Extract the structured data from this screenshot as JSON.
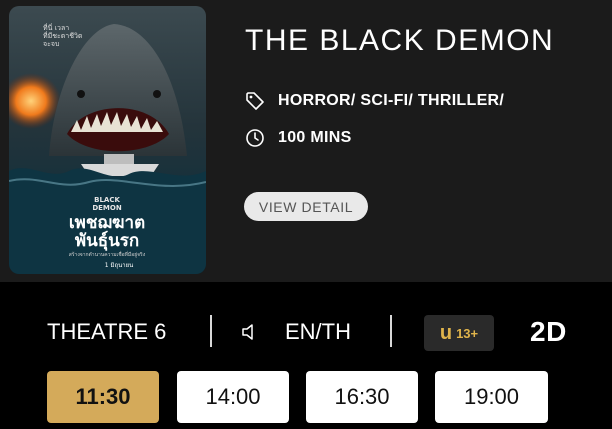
{
  "movie": {
    "title": "THE BLACK DEMON",
    "genres": "HORROR/ SCI-FI/ THRILLER/",
    "duration": "100 MINS",
    "view_detail_label": "VIEW DETAIL",
    "poster": {
      "top_text": "ที่นี่ เวลา\nที่มีชะตาชีวิต\nจะจบ",
      "logo_line1": "BLACK",
      "logo_line2": "DEMON",
      "thai_title_line1": "เพชฌฆาต",
      "thai_title_line2": "พันธุ์นรก",
      "tagline": "สร้างจากตำนานความเชื่อที่มีอยู่จริง",
      "footer": "1 มิถุนายน"
    }
  },
  "showing": {
    "theatre": "THEATRE 6",
    "language": "EN/TH",
    "rating_letter": "u",
    "rating_age": "13+",
    "format": "2D"
  },
  "showtimes": [
    "11:30",
    "14:00",
    "16:30",
    "19:00"
  ],
  "selected_showtime": "11:30",
  "icons": {
    "genre": "tag-icon",
    "duration": "clock-icon",
    "audio": "speaker-icon"
  },
  "colors": {
    "page_bg": "#000000",
    "panel_bg": "#1b1b1b",
    "selected_showtime": "#d4aa5a",
    "rating_text": "#e0b44b",
    "button_bg": "#e9e9e9"
  }
}
